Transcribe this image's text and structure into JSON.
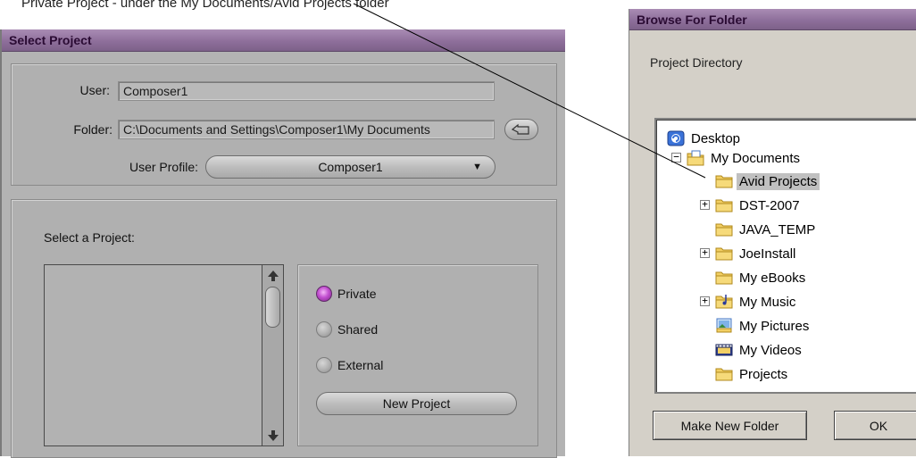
{
  "caption": "Private Project - under the My Documents/Avid Projects folder",
  "select_project": {
    "title": "Select Project",
    "user_label": "User:",
    "user_value": "Composer1",
    "folder_label": "Folder:",
    "folder_value": "C:\\Documents and Settings\\Composer1\\My Documents",
    "user_profile_label": "User Profile:",
    "user_profile_value": "Composer1",
    "select_label": "Select a Project:",
    "projects": [],
    "radio_options": [
      "Private",
      "Shared",
      "External"
    ],
    "radio_selected": "Private",
    "new_project_label": "New Project"
  },
  "browse_folder": {
    "title": "Browse For Folder",
    "description": "Project Directory",
    "tree": [
      {
        "label": "Desktop",
        "icon": "desktop-icon"
      },
      {
        "label": "My Documents",
        "icon": "documents-folder-icon",
        "expander": "minus"
      },
      {
        "label": "Avid Projects",
        "icon": "folder-icon",
        "selected": true
      },
      {
        "label": "DST-2007",
        "icon": "folder-icon",
        "expander": "plus"
      },
      {
        "label": "JAVA_TEMP",
        "icon": "folder-icon"
      },
      {
        "label": "JoeInstall",
        "icon": "folder-icon",
        "expander": "plus"
      },
      {
        "label": "My eBooks",
        "icon": "folder-icon"
      },
      {
        "label": "My Music",
        "icon": "music-folder-icon",
        "expander": "plus"
      },
      {
        "label": "My Pictures",
        "icon": "pictures-folder-icon"
      },
      {
        "label": "My Videos",
        "icon": "videos-folder-icon"
      },
      {
        "label": "Projects",
        "icon": "folder-icon"
      }
    ],
    "make_new_folder_label": "Make New Folder",
    "ok_label": "OK"
  },
  "colors": {
    "titlebar": "#8e6f9b",
    "radio_selected": "#c24fd0",
    "folder_yellow": "#f2cf63"
  }
}
